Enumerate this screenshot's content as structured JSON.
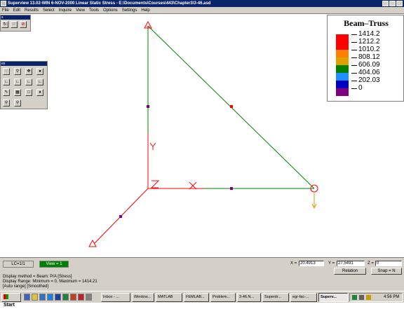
{
  "window": {
    "title": "Superview 13.02-WIN 6-NOV-2000 Linear Static Stress - E:\\Documents\\Courses\\443\\Chapter3\\3-46.asd"
  },
  "menu": [
    "File",
    "Edit",
    "Results",
    "Select",
    "Inquire",
    "View",
    "Tools",
    "Options",
    "Settings",
    "Help"
  ],
  "toolbars": {
    "small_title": "s",
    "palette_title": "es"
  },
  "legend": {
    "title": "Beam–Truss",
    "entries": [
      {
        "label": "1414.2",
        "color": "#ff0000"
      },
      {
        "label": "1212.2",
        "color": "#ff0000"
      },
      {
        "label": "1010.2",
        "color": "#ff8000"
      },
      {
        "label": "808.12",
        "color": "#e0a000"
      },
      {
        "label": "606.09",
        "color": "#008000"
      },
      {
        "label": "404.06",
        "color": "#1f8fff"
      },
      {
        "label": "202.03",
        "color": "#0000c0"
      },
      {
        "label": "0",
        "color": "#800080"
      }
    ]
  },
  "model": {
    "member_color_main": "#008000",
    "member_color_ref": "#ff0000",
    "node_color_mid": "#800080",
    "node_color_high": "#ff0000",
    "load_color": "#e0a000",
    "axis_labels": {
      "x": "X",
      "y": "Y",
      "z": "Z"
    }
  },
  "status": {
    "lc": "LC=1/1",
    "view": "View = 1",
    "x_label": "X =",
    "x_value": "20.4913",
    "y_label": "Y =",
    "y_value": "27.5491",
    "z_label": "Z =",
    "z_value": "0",
    "relation_button": "Relation",
    "snap_button": "Snap = N",
    "lines": [
      "Display method = Beam: P/A  [Stress]",
      "Display Range: Minimum = 0, Maximum = 1414.21",
      "[Auto range]  [Smoothed]"
    ]
  },
  "taskbar": {
    "start": "Start",
    "tasks": [
      "Inbox - ...",
      "Window...",
      "MATLAB",
      "FEMLAB...",
      "Problem...",
      "3-46.N...",
      "Superdr...",
      "egr-fac-...",
      "Superv..."
    ],
    "active_task": "Superv...",
    "clock": "4:56 PM"
  }
}
